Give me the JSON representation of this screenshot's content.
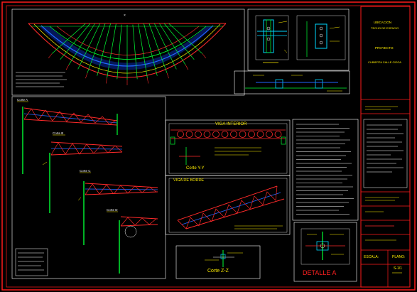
{
  "sheet": {
    "background": "#000000",
    "frame_color": "#ff1a1a",
    "line_colors": {
      "truss": "#ff2a2a",
      "column": "#00ff33",
      "beam": "#2266ff",
      "text": "#ffee00",
      "note": "#ffffff",
      "cyan": "#00d8ff"
    }
  },
  "views": {
    "plan": {
      "title": ""
    },
    "detail_top": {
      "title": ""
    },
    "side_sections": {
      "labels": [
        "Corte A",
        "Corte B",
        "Corte C",
        "Corte D"
      ]
    },
    "viga_interior": {
      "title": "VIGA INTERIOR",
      "caption": "Corte Y-Y"
    },
    "viga_borde": {
      "title": "VIGA DE BORDE"
    },
    "corte_zz": {
      "caption": "Corte Z-Z"
    },
    "detalle_a": {
      "caption": "DETALLE A"
    }
  },
  "title_block": {
    "line1": "UBICACION",
    "line2": "TECHO DE ESPACIO",
    "proyecto_label": "PROYECTO:",
    "proyecto_value": "CUBIERTA CALLE CIEGA",
    "escala_label": "ESCALA:",
    "plano_label": "PLANO:",
    "plano_value": "S-1/1"
  }
}
